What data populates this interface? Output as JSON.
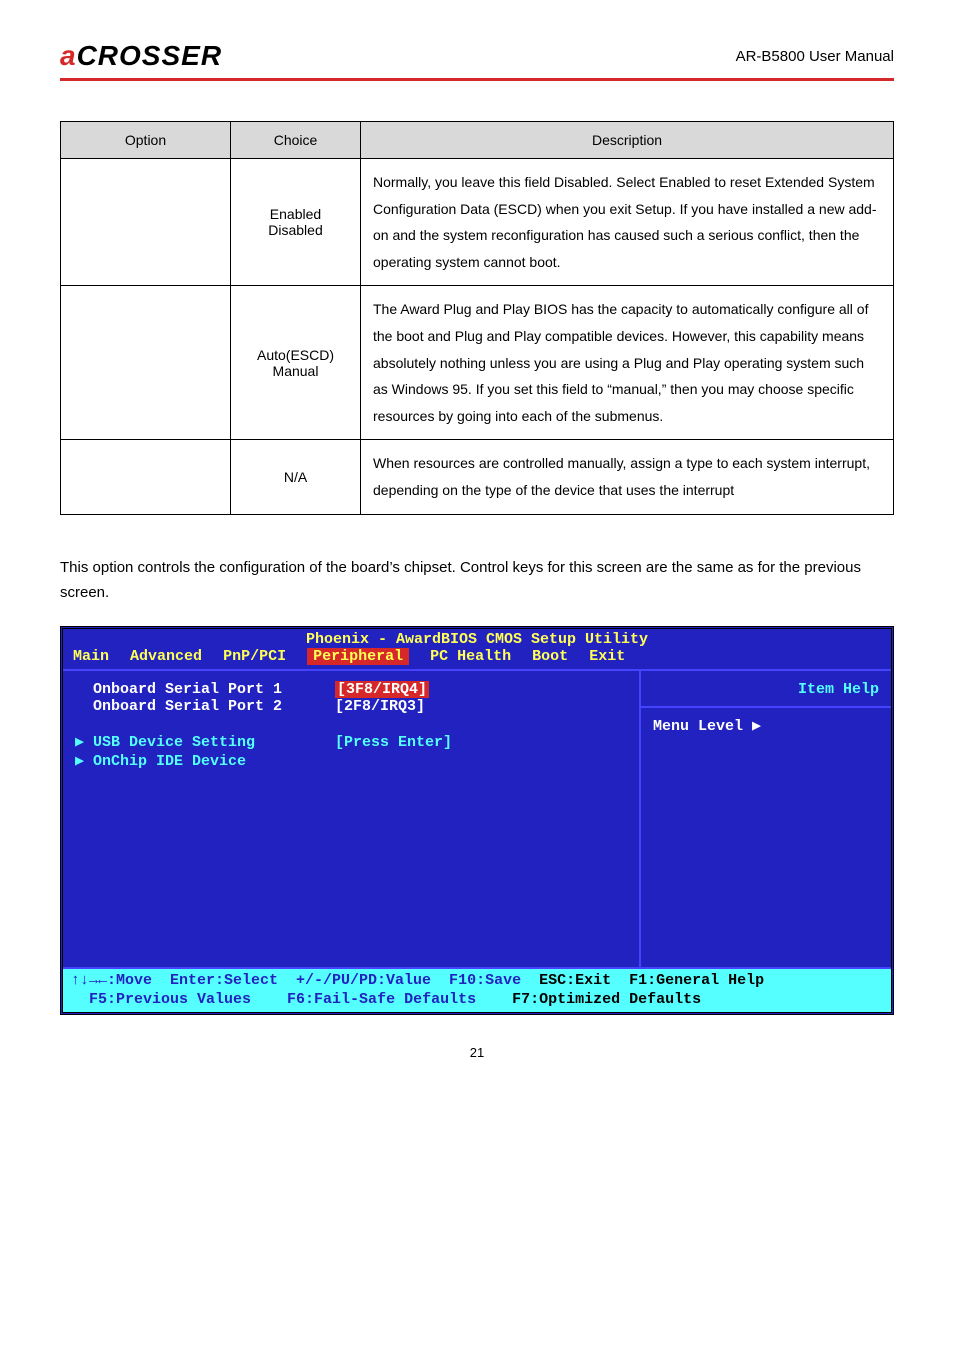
{
  "header": {
    "logo_prefix": "a",
    "logo_rest": "CROSSER",
    "product": "AR-B5800 User Manual"
  },
  "table": {
    "headers": {
      "option": "Option",
      "choice": "Choice",
      "description": "Description"
    },
    "rows": [
      {
        "option": "",
        "choice": "Enabled\nDisabled",
        "desc": "Normally, you leave this field Disabled. Select Enabled to reset Extended System Configuration Data (ESCD) when you exit Setup. If you have installed a new add-on and the system reconfiguration has caused such a serious conflict, then the operating system cannot boot."
      },
      {
        "option": "",
        "choice": "Auto(ESCD)\nManual",
        "desc": "The Award Plug and Play BIOS has the capacity to automatically configure all of the boot and Plug and Play compatible devices. However, this capability means absolutely nothing unless you are using a Plug and Play operating system such as Windows 95. If you set this field to “manual,” then you may choose specific resources by going into each of the submenus."
      },
      {
        "option": "",
        "choice": "N/A",
        "desc": "When resources are controlled manually, assign a type to each system interrupt, depending on the type of the device that uses the interrupt"
      }
    ]
  },
  "bodytext": "This option controls the configuration of the board’s chipset. Control keys for this screen are the same as for the previous screen.",
  "bios": {
    "title": "Phoenix - AwardBIOS CMOS Setup Utility",
    "menu": [
      "Main",
      "Advanced",
      "PnP/PCI",
      "Peripheral",
      "PC Health",
      "Boot",
      "Exit"
    ],
    "menu_selected_index": 3,
    "left": [
      {
        "label": "Onboard Serial Port 1",
        "value": "[3F8/IRQ4]",
        "selected": true
      },
      {
        "label": "Onboard Serial Port 2",
        "value": "[2F8/IRQ3]",
        "selected": false
      },
      {
        "label": "",
        "value": "",
        "spacer": true
      },
      {
        "label": "▶ USB Device Setting",
        "value": "[Press Enter]",
        "cyan": true
      },
      {
        "label": "▶ OnChip IDE Device",
        "value": "",
        "cyan": true
      }
    ],
    "right": {
      "item_help": "Item Help",
      "menu_level": "Menu Level   ▶"
    },
    "footer": {
      "line1_left": "↑↓→←:Move  Enter:Select  +/-/PU/PD:Value  F10:Save",
      "line1_right": "ESC:Exit  F1:General Help",
      "line2_left": "F5:Previous Values    F6:Fail-Safe Defaults",
      "line2_right": "F7:Optimized Defaults"
    }
  },
  "pagenum": "21"
}
